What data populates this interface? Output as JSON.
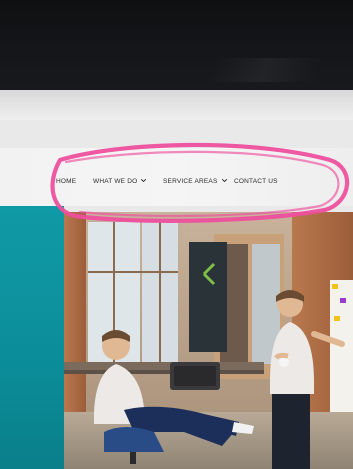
{
  "nav": {
    "items": [
      {
        "label": "HOME",
        "has_dropdown": false
      },
      {
        "label": "WHAT WE DO",
        "has_dropdown": true
      },
      {
        "label": "SERVICE AREAS",
        "has_dropdown": true
      },
      {
        "label": "CONTACT US",
        "has_dropdown": false
      }
    ]
  },
  "icons": {
    "dropdown": "chevron-down-icon"
  },
  "colors": {
    "annotation": "#ee4f9d",
    "teal_panel": "#0b8d99",
    "nav_bg": "#f3f3f3"
  }
}
